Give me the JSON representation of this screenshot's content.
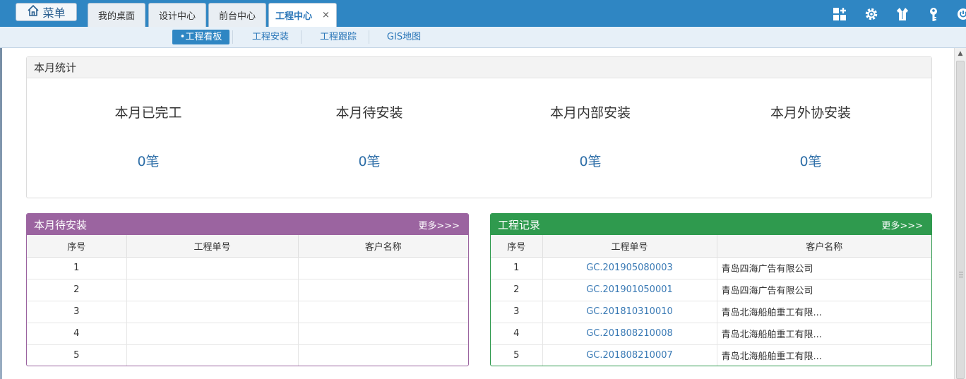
{
  "topbar": {
    "menu_label": "菜单",
    "tabs": [
      {
        "label": "我的桌面"
      },
      {
        "label": "设计中心"
      },
      {
        "label": "前台中心"
      },
      {
        "label": "工程中心",
        "close": "×"
      }
    ],
    "icons": [
      "grid-plus-icon",
      "gear-icon",
      "shirt-icon",
      "key-icon",
      "power-icon"
    ]
  },
  "subnav": {
    "items": [
      {
        "label": "•工程看板"
      },
      {
        "label": "工程安装"
      },
      {
        "label": "工程跟踪"
      },
      {
        "label": "GIS地图"
      }
    ]
  },
  "stats": {
    "title": "本月统计",
    "items": [
      {
        "label": "本月已完工",
        "value": "0笔"
      },
      {
        "label": "本月待安装",
        "value": "0笔"
      },
      {
        "label": "本月内部安装",
        "value": "0笔"
      },
      {
        "label": "本月外协安装",
        "value": "0笔"
      }
    ]
  },
  "pending": {
    "title": "本月待安装",
    "more": "更多>>>",
    "color": "#9b64a0",
    "columns": [
      "序号",
      "工程单号",
      "客户名称"
    ],
    "rows": [
      {
        "no": "1",
        "order": "",
        "customer": ""
      },
      {
        "no": "2",
        "order": "",
        "customer": ""
      },
      {
        "no": "3",
        "order": "",
        "customer": ""
      },
      {
        "no": "4",
        "order": "",
        "customer": ""
      },
      {
        "no": "5",
        "order": "",
        "customer": ""
      }
    ]
  },
  "records": {
    "title": "工程记录",
    "more": "更多>>>",
    "color": "#2f9a4e",
    "columns": [
      "序号",
      "工程单号",
      "客户名称"
    ],
    "rows": [
      {
        "no": "1",
        "order": "GC.201905080003",
        "customer": "青岛四海广告有限公司"
      },
      {
        "no": "2",
        "order": "GC.201901050001",
        "customer": "青岛四海广告有限公司"
      },
      {
        "no": "3",
        "order": "GC.201810310010",
        "customer": "青岛北海船舶重工有限..."
      },
      {
        "no": "4",
        "order": "GC.201808210008",
        "customer": "青岛北海船舶重工有限..."
      },
      {
        "no": "5",
        "order": "GC.201808210007",
        "customer": "青岛北海船舶重工有限..."
      }
    ]
  },
  "colors": {
    "topbar": "#2f86c3",
    "accent": "#2a76b8"
  }
}
